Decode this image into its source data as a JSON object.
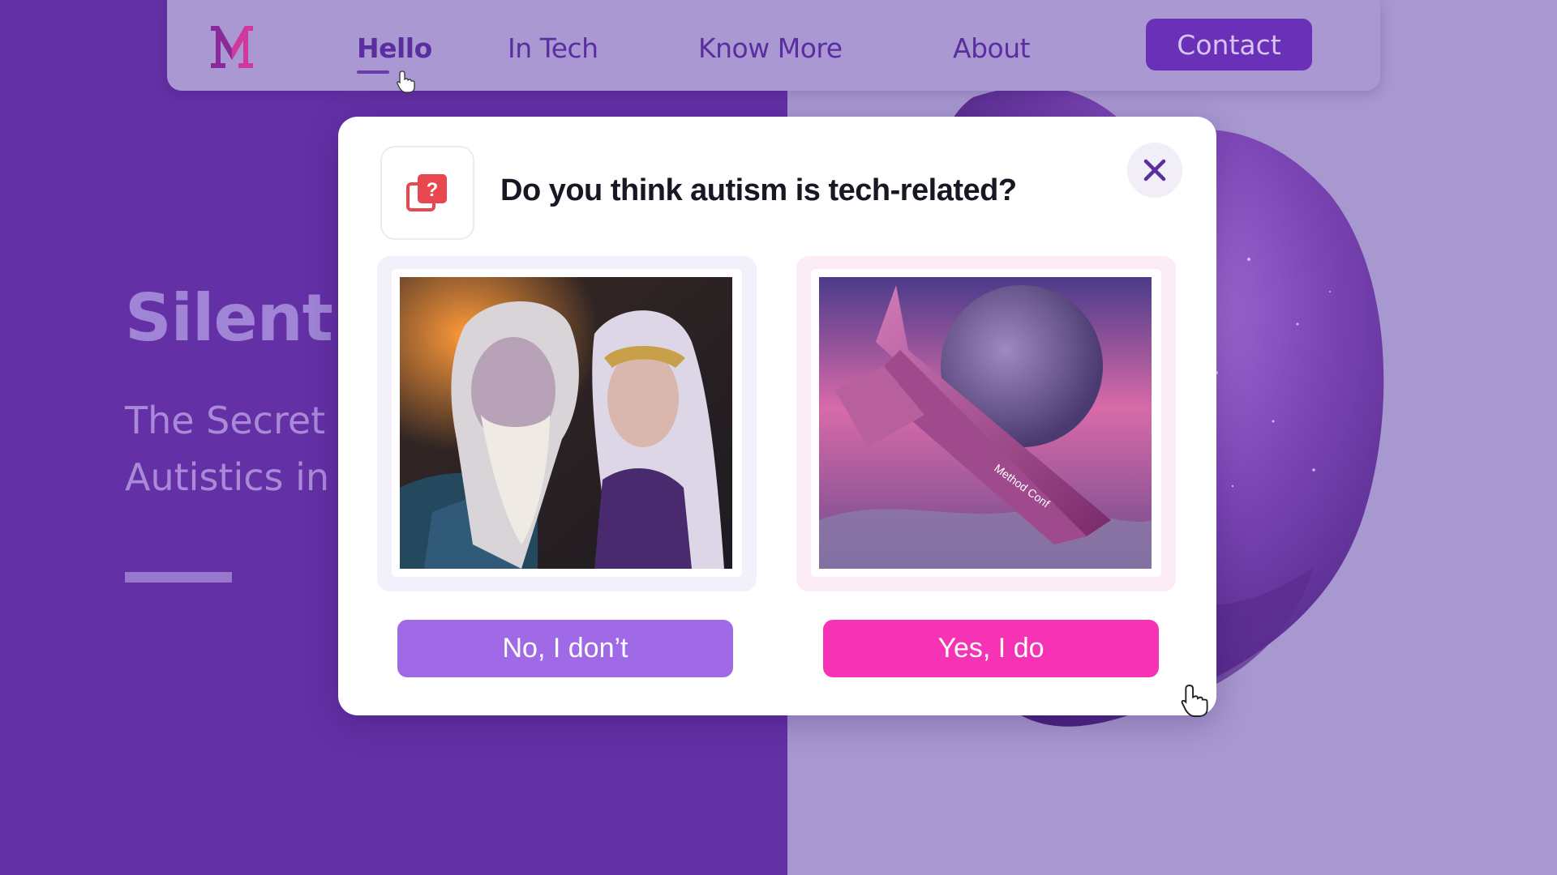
{
  "nav": {
    "logo_text": "M",
    "items": [
      {
        "label": "Hello",
        "active": true
      },
      {
        "label": "In Tech"
      },
      {
        "label": "Know More"
      },
      {
        "label": "About"
      }
    ],
    "contact_label": "Contact"
  },
  "hero": {
    "title": "Silent I",
    "subtitle_line1": "The Secret",
    "subtitle_line2": "Autistics in"
  },
  "modal": {
    "question": "Do you think autism is tech-related?",
    "icon": "question-cards-icon",
    "close_icon": "close-icon",
    "options": [
      {
        "image": "fantasy-elves-portrait",
        "button_label": "No, I don’t"
      },
      {
        "image": "pink-spaceship-over-planet",
        "button_label": "Yes, I do",
        "ship_text": "Method Conf"
      }
    ]
  },
  "colors": {
    "primary_purple": "#6430a6",
    "no_button": "#a06ae6",
    "yes_button": "#f533b4",
    "nav_bg": "#a998d2"
  }
}
